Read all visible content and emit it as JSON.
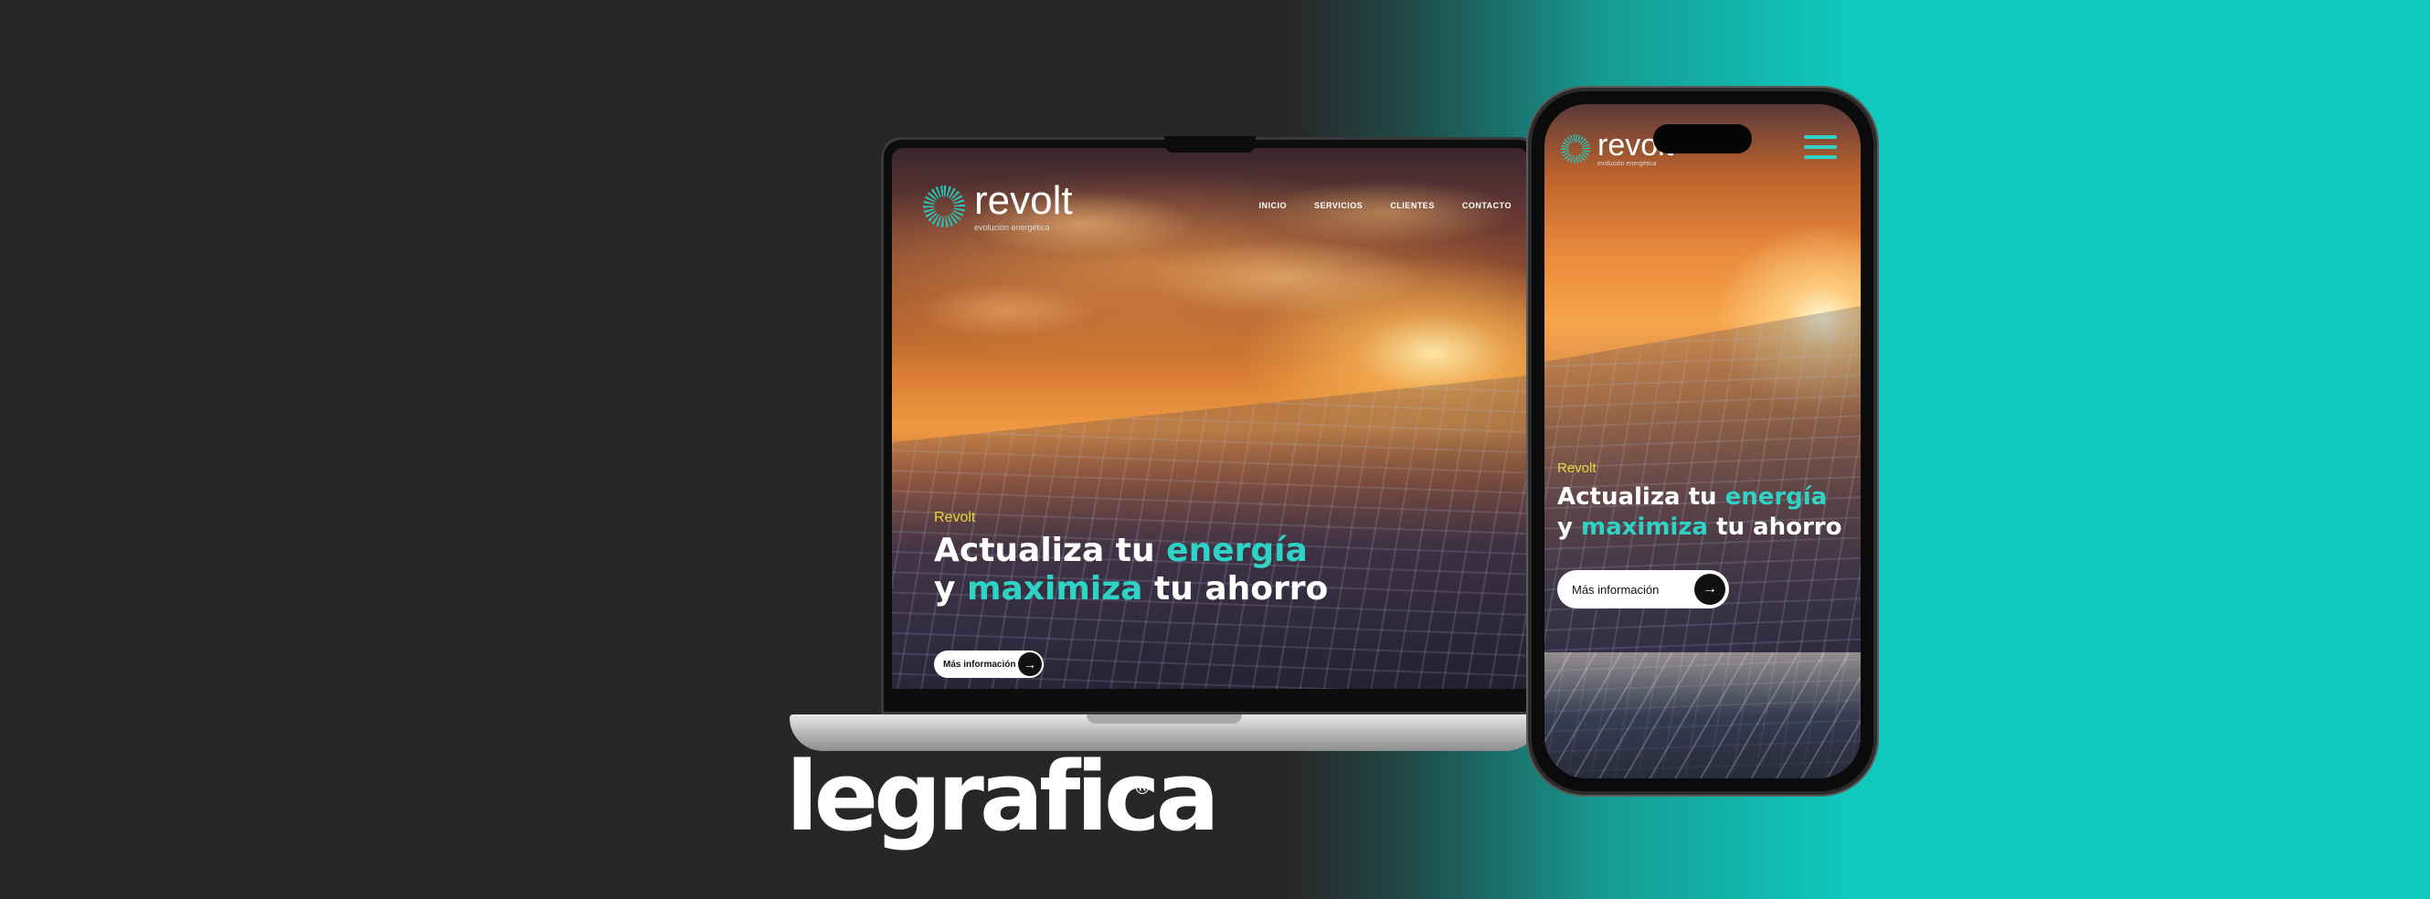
{
  "site": {
    "brand_name": "revolt",
    "brand_tagline": "evolución energética",
    "nav": [
      "INICIO",
      "SERVICIOS",
      "CLIENTES",
      "CONTACTO"
    ],
    "eyebrow": "Revolt",
    "headline_part1": "Actualiza tu ",
    "headline_accent1": "energía",
    "headline_part2": "y ",
    "headline_accent2": "maximiza",
    "headline_part3": " tu ahorro",
    "cta_label": "Más información",
    "cta_arrow": "→"
  },
  "agency": {
    "name": "legrafica",
    "registered_mark": "®"
  },
  "icons": {
    "logo": "sunburst-logo-icon",
    "menu": "hamburger-menu-icon",
    "arrow": "arrow-right-icon"
  },
  "colors": {
    "accent": "#2fd3c6",
    "eyebrow": "#e7d73a",
    "background_dark": "#272727",
    "background_teal": "#10c8bc"
  }
}
